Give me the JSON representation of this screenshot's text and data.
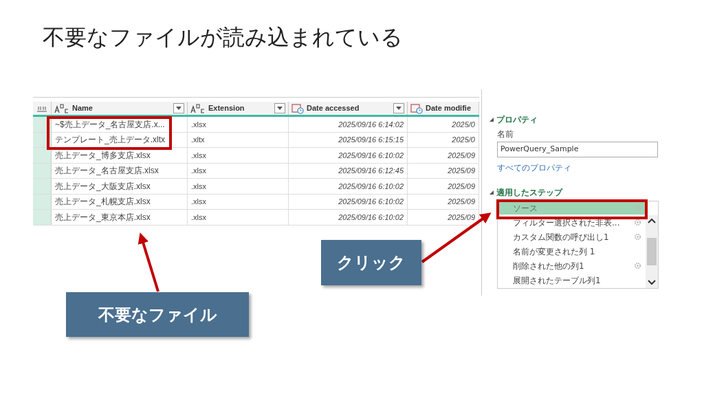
{
  "slide_title": "不要なファイルが読み込まれている",
  "table": {
    "columns": [
      {
        "label": "Name",
        "kind": "text"
      },
      {
        "label": "Extension",
        "kind": "text"
      },
      {
        "label": "Date accessed",
        "kind": "date"
      },
      {
        "label": "Date modifie",
        "kind": "date"
      }
    ],
    "rows": [
      [
        "~$売上データ_名古屋支店.x...",
        ".xlsx",
        "2025/09/16 6:14:02",
        "2025/0"
      ],
      [
        "テンプレート_売上データ.xltx",
        ".xltx",
        "2025/09/16 6:15:15",
        "2025/0"
      ],
      [
        "売上データ_博多支店.xlsx",
        ".xlsx",
        "2025/09/16 6:10:02",
        "2025/09"
      ],
      [
        "売上データ_名古屋支店.xlsx",
        ".xlsx",
        "2025/09/16 6:12:45",
        "2025/09"
      ],
      [
        "売上データ_大阪支店.xlsx",
        ".xlsx",
        "2025/09/16 6:10:02",
        "2025/09"
      ],
      [
        "売上データ_札幌支店.xlsx",
        ".xlsx",
        "2025/09/16 6:10:02",
        "2025/09"
      ],
      [
        "売上データ_東京本店.xlsx",
        ".xlsx",
        "2025/09/16 6:10:02",
        "2025/09"
      ]
    ]
  },
  "settings": {
    "properties_heading": "プロパティ",
    "name_label": "名前",
    "name_value": "PowerQuery_Sample",
    "all_properties_link": "すべてのプロパティ",
    "steps_heading": "適用したステップ",
    "steps": [
      {
        "label": "ソース",
        "selected": true,
        "gear": true
      },
      {
        "label": "フィルター選択された非表...",
        "selected": false,
        "gear": true
      },
      {
        "label": "カスタム関数の呼び出し1",
        "selected": false,
        "gear": true
      },
      {
        "label": "名前が変更された列 1",
        "selected": false,
        "gear": false
      },
      {
        "label": "削除された他の列1",
        "selected": false,
        "gear": true
      },
      {
        "label": "展開されたテーブル列1",
        "selected": false,
        "gear": false
      }
    ]
  },
  "callouts": [
    {
      "text": "不要なファイル"
    },
    {
      "text": "クリック"
    }
  ]
}
